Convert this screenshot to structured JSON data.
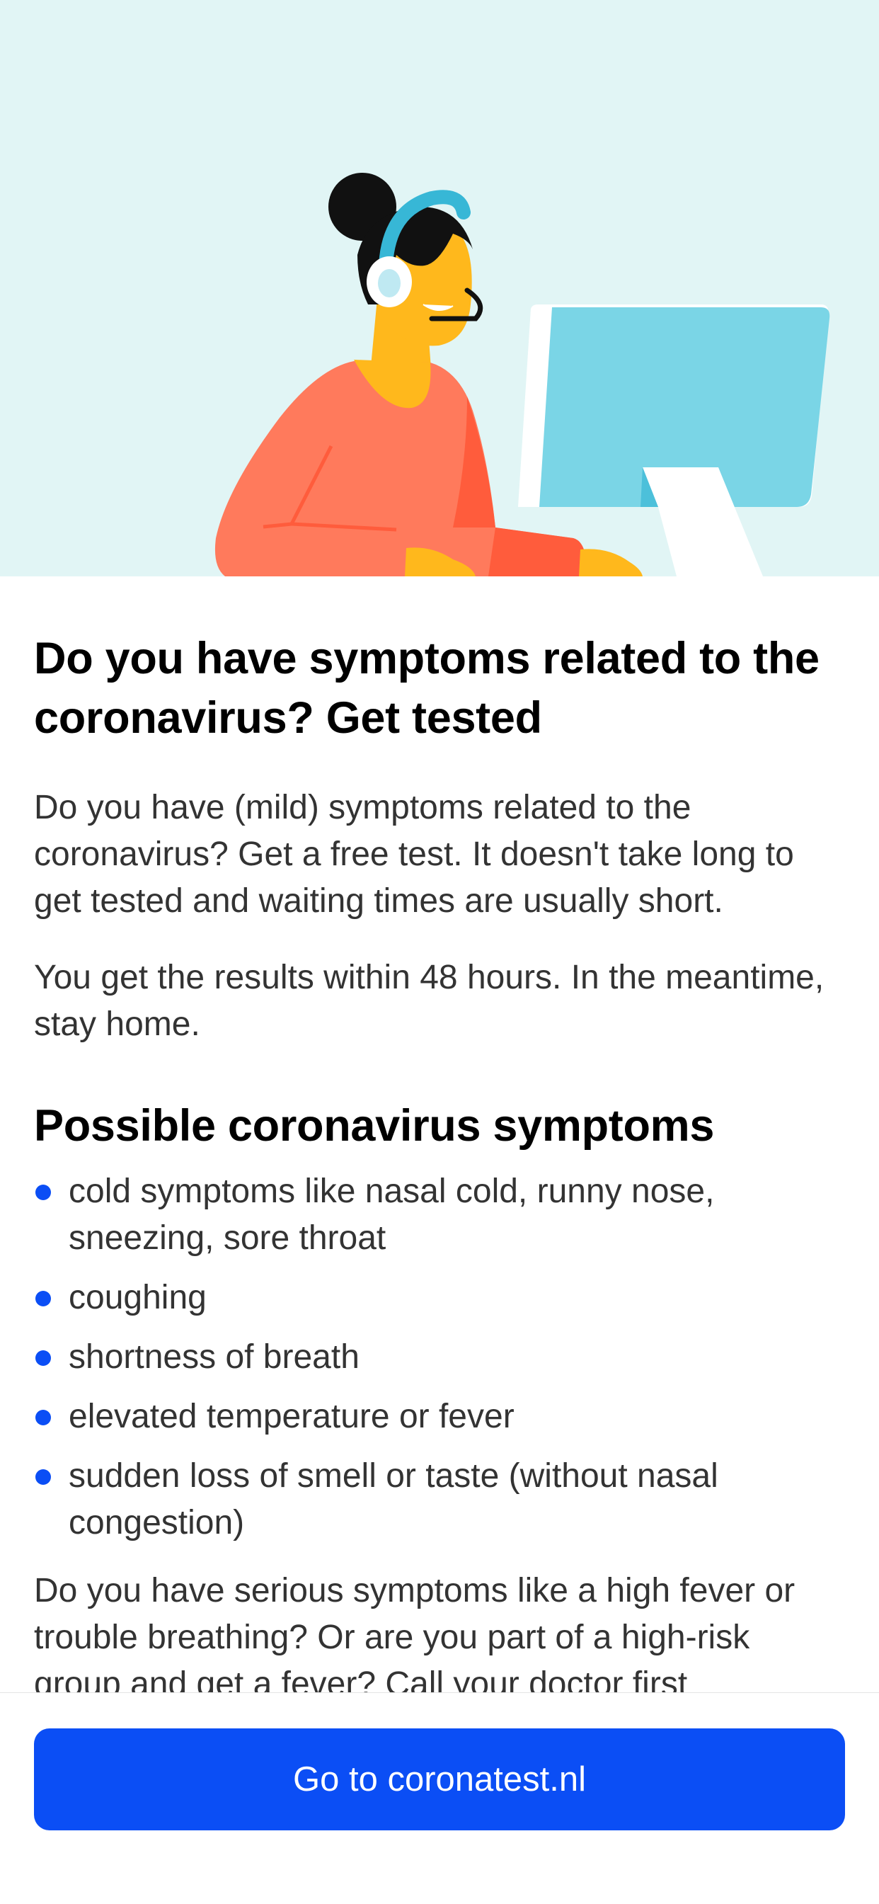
{
  "illustration": {
    "icon": "call-center-agent-illustration",
    "colors": {
      "background": "#e1f5f5",
      "monitor": "#7ad5e6",
      "sweater": "#ff7a5c",
      "skin": "#ffb81c",
      "headset": "#37b7d6"
    }
  },
  "content": {
    "title": "Do you have symptoms related to the coronavirus? Get tested",
    "intro": "Do you have (mild) symptoms related to the coronavirus? Get a free test. It doesn't take long to get tested and waiting times are usually short.",
    "results": "You get the results within 48 hours. In the meantime, stay home.",
    "symptoms_heading": "Possible coronavirus symptoms",
    "symptoms": [
      "cold symptoms like nasal cold, runny nose, sneezing, sore throat",
      "coughing",
      "shortness of breath",
      "elevated temperature or fever",
      "sudden loss of smell or taste (without nasal congestion)"
    ],
    "serious": "Do you have serious symptoms like a high fever or trouble breathing? Or are you part of a high-risk group and get a fever? Call your doctor first"
  },
  "footer": {
    "cta_label": "Go to coronatest.nl"
  },
  "colors": {
    "accent": "#0b4ef5",
    "bullet": "#0b4ef5"
  }
}
